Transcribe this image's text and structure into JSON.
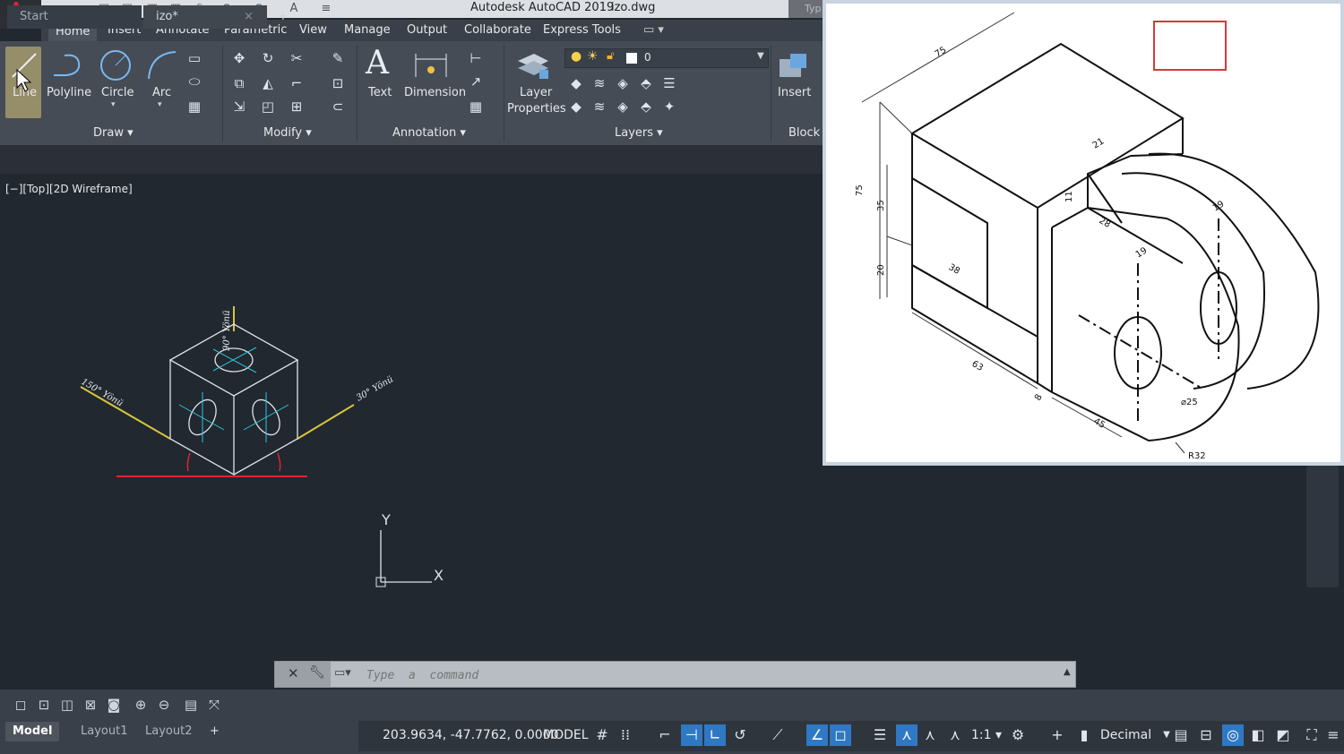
{
  "titlebar": {
    "app_title": "Autodesk AutoCAD 2019",
    "file_name": "izo.dwg",
    "search_stub": "Typ"
  },
  "ribbon": {
    "tabs": [
      "Home",
      "Insert",
      "Annotate",
      "Parametric",
      "View",
      "Manage",
      "Output",
      "Collaborate",
      "Express Tools"
    ],
    "draw": {
      "line": "Line",
      "polyline": "Polyline",
      "circle": "Circle",
      "arc": "Arc",
      "panel": "Draw ▾"
    },
    "modify": {
      "panel": "Modify ▾"
    },
    "annotation": {
      "text": "Text",
      "dimension": "Dimension",
      "panel": "Annotation ▾"
    },
    "layers": {
      "layer_properties_1": "Layer",
      "layer_properties_2": "Properties",
      "current_layer": "0",
      "panel": "Layers ▾"
    },
    "block": {
      "insert": "Insert",
      "panel": "Block"
    }
  },
  "file_tabs": {
    "start": "Start",
    "izo": "izo*",
    "close": "×",
    "new": "+"
  },
  "viewport": {
    "label": "[−][Top][2D Wireframe]",
    "y_axis": "Y",
    "x_axis": "X"
  },
  "iso_cube": {
    "top_label": "90° Yönü",
    "left_label": "150° Yönü",
    "right_label": "30° Yönü"
  },
  "reference_drawing": {
    "dims": [
      "75",
      "75",
      "35",
      "20",
      "21",
      "11",
      "28",
      "19",
      "38",
      "19",
      "63",
      "8",
      "45",
      "⌀25",
      "R32"
    ]
  },
  "command_line": {
    "placeholder": "Type  a  command"
  },
  "layout_tabs": {
    "model": "Model",
    "layout1": "Layout1",
    "layout2": "Layout2",
    "add": "+"
  },
  "statusbar": {
    "coords": "203.9634, -47.7762, 0.0000",
    "model": "MODEL",
    "scale": "1:1 ▾",
    "units": "Decimal"
  },
  "colors": {
    "accent": "#2f78c4",
    "viewport_bg": "#212830",
    "ribbon_bg": "#454c56",
    "logo_red": "#e0252b"
  }
}
